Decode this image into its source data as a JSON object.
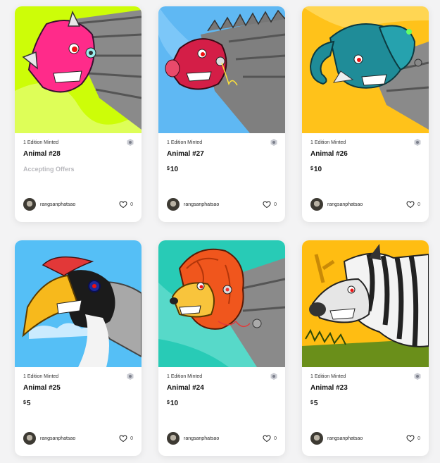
{
  "cards": [
    {
      "edition": "1 Edition Minted",
      "title": "Animal #28",
      "price_currency": "",
      "price": "",
      "status": "Accepting Offers",
      "creator": "rangsanphatsao",
      "likes": "0",
      "chain_icon": "chain-icon",
      "bg": "#cdfd08",
      "animal": "rhino"
    },
    {
      "edition": "1 Edition Minted",
      "title": "Animal #27",
      "price_currency": "$",
      "price": "10",
      "status": "",
      "creator": "rangsanphatsao",
      "likes": "0",
      "chain_icon": "chain-icon",
      "bg": "#5fb8f3",
      "animal": "boar"
    },
    {
      "edition": "1 Edition Minted",
      "title": "Animal #26",
      "price_currency": "$",
      "price": "10",
      "status": "",
      "creator": "rangsanphatsao",
      "likes": "0",
      "chain_icon": "chain-icon",
      "bg": "#ffc21a",
      "animal": "elephant"
    },
    {
      "edition": "1 Edition Minted",
      "title": "Animal #25",
      "price_currency": "$",
      "price": "5",
      "status": "",
      "creator": "rangsanphatsao",
      "likes": "0",
      "chain_icon": "chain-icon",
      "bg": "#55bff6",
      "animal": "hornbill"
    },
    {
      "edition": "1 Edition Minted",
      "title": "Animal #24",
      "price_currency": "$",
      "price": "10",
      "status": "",
      "creator": "rangsanphatsao",
      "likes": "0",
      "chain_icon": "chain-icon",
      "bg": "#28cbb6",
      "animal": "lion"
    },
    {
      "edition": "1 Edition Minted",
      "title": "Animal #23",
      "price_currency": "$",
      "price": "5",
      "status": "",
      "creator": "rangsanphatsao",
      "likes": "0",
      "chain_icon": "chain-icon",
      "bg": "#ffbd12",
      "animal": "zebra"
    }
  ]
}
